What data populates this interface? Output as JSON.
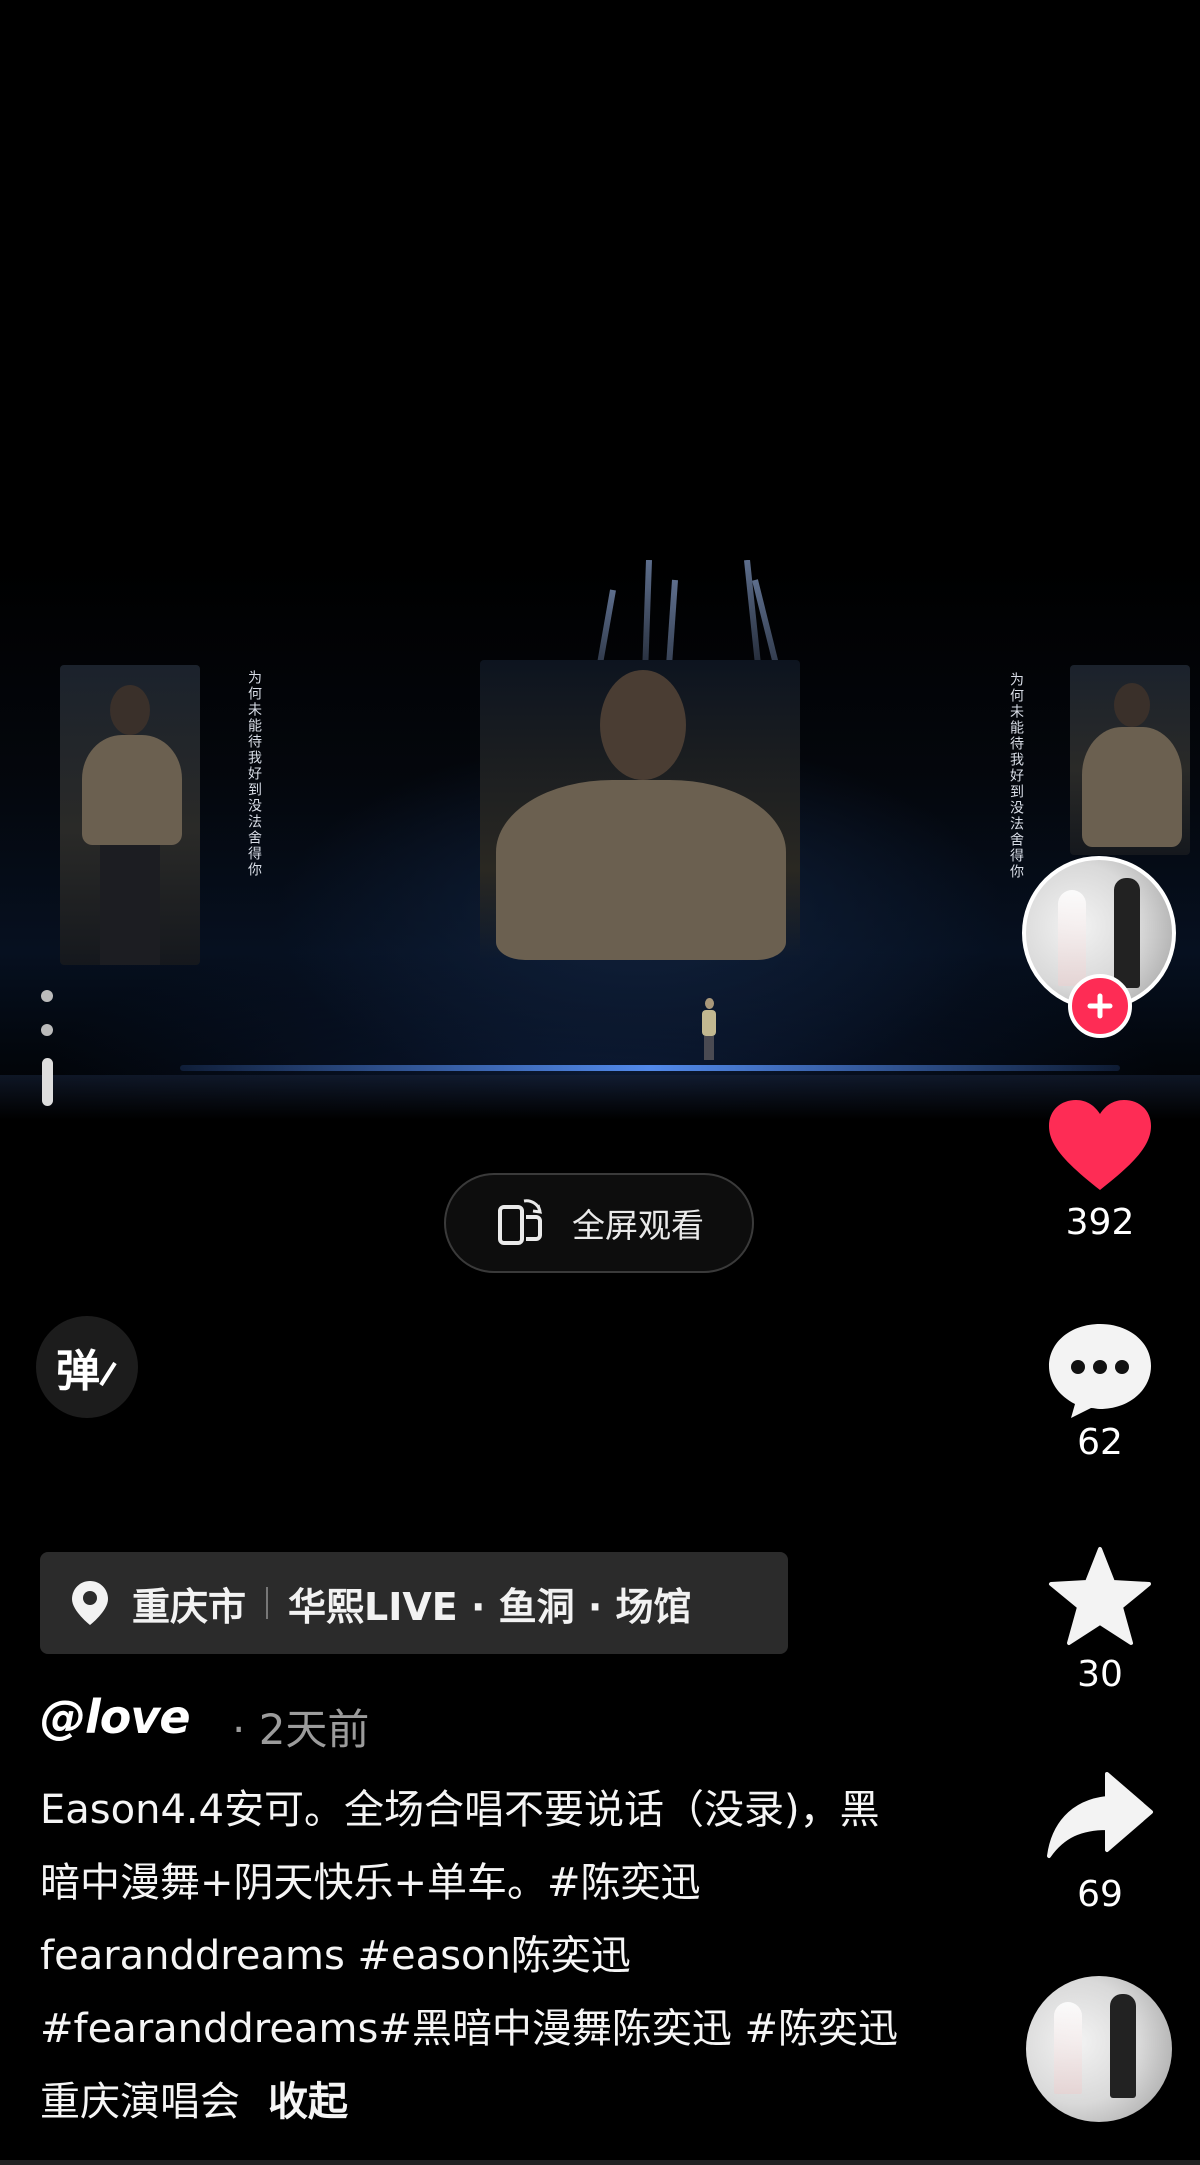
{
  "video": {
    "lyric_left": "为何未能待我好到没法舍得你",
    "lyric_right": "为何未能待我好到没法舍得你"
  },
  "player": {
    "fullscreen_label": "全屏观看",
    "danmaku_label": "弹"
  },
  "actions": {
    "likes": "392",
    "comments": "62",
    "favorites": "30",
    "shares": "69",
    "like_color": "#fe2c55",
    "follow_color": "#fe2c55"
  },
  "location": {
    "city": "重庆市",
    "place": "华熙LIVE · 鱼洞 · 场馆"
  },
  "post": {
    "author": "@love",
    "time": "· 2天前",
    "caption": "Eason4.4安可。全场合唱不要说话（没录)，黑暗中漫舞+阴天快乐+单车。#陈奕迅fearanddreams #eason陈奕迅 #fearanddreams#黑暗中漫舞陈奕迅 #陈奕迅重庆演唱会",
    "collapse_label": "收起"
  }
}
